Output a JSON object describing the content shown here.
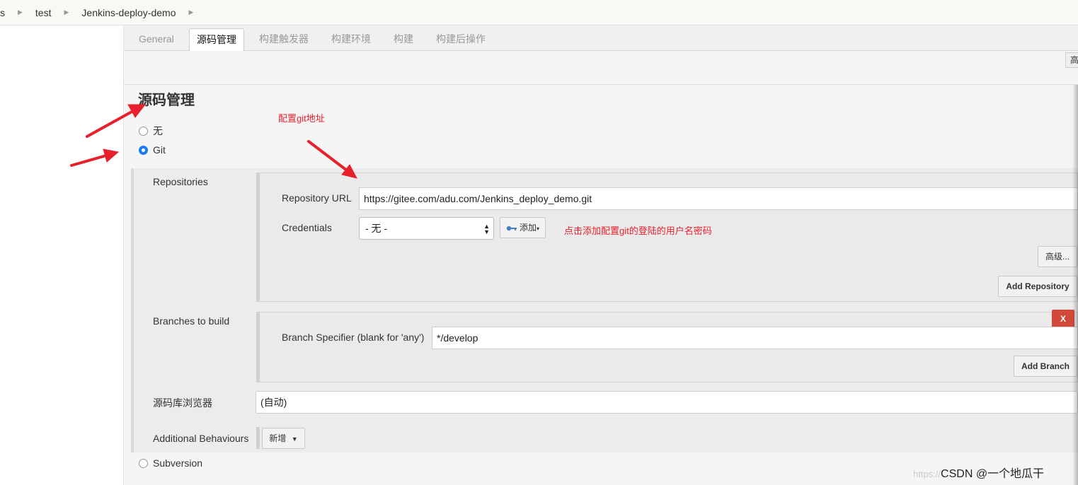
{
  "breadcrumb": {
    "items": [
      "s",
      "test",
      "Jenkins-deploy-demo"
    ]
  },
  "tabs": [
    "General",
    "源码管理",
    "构建触发器",
    "构建环境",
    "构建",
    "构建后操作"
  ],
  "top_advanced_label": "高",
  "section_title": "源码管理",
  "scm_options": {
    "none": "无",
    "git": "Git",
    "svn": "Subversion"
  },
  "repositories": {
    "label": "Repositories",
    "url_label": "Repository URL",
    "url_value": "https://gitee.com/adu.com/Jenkins_deploy_demo.git",
    "credentials_label": "Credentials",
    "credentials_value": "- 无 -",
    "add_button": "添加",
    "advanced_button": "高级...",
    "add_repository_button": "Add Repository"
  },
  "branches": {
    "label": "Branches to build",
    "delete_button": "X",
    "specifier_label": "Branch Specifier (blank for 'any')",
    "specifier_value": "*/develop",
    "add_branch_button": "Add Branch"
  },
  "browser": {
    "label": "源码库浏览器",
    "value": "(自动)"
  },
  "behaviours": {
    "label": "Additional Behaviours",
    "add_button": "新增"
  },
  "annotations": {
    "git_url_note": "配置git地址",
    "credentials_note": "点击添加配置git的登陆的用户名密码"
  },
  "watermark": {
    "faint": "https://",
    "main": "CSDN @一个地瓜干"
  },
  "colors": {
    "annotation": "#e8202c",
    "selected_radio": "#1a7cf3",
    "delete_button": "#d24939"
  }
}
